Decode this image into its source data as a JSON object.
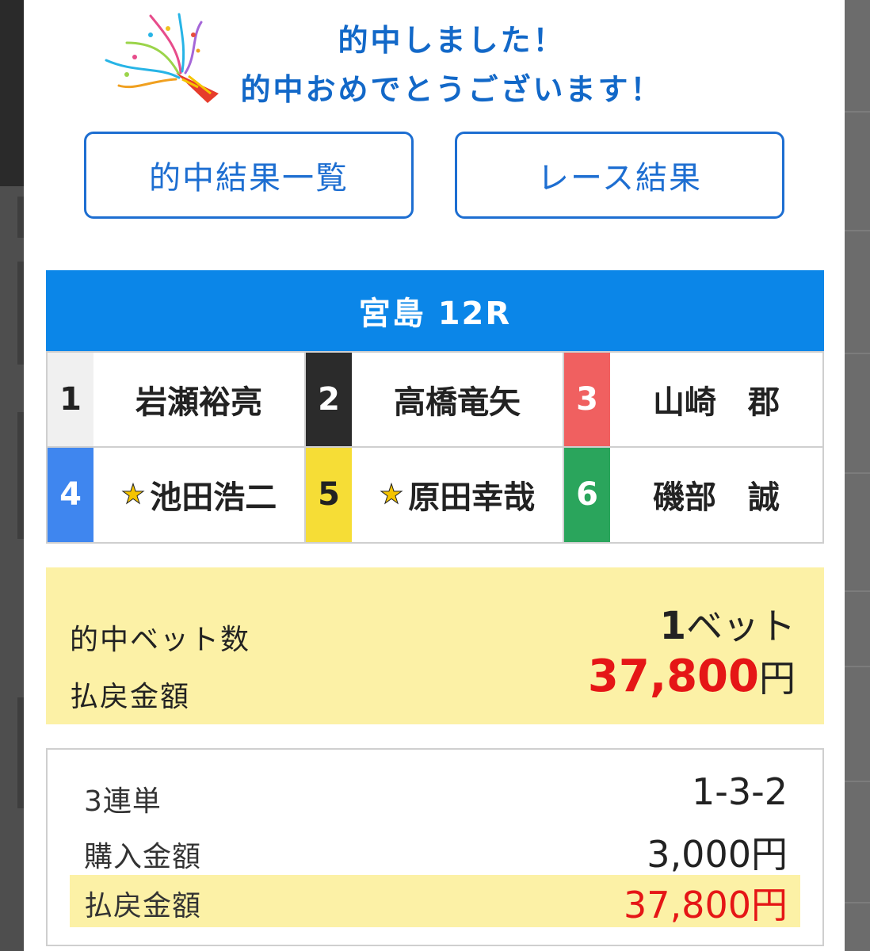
{
  "congrats": {
    "line1": "的中しました！",
    "line2": "的中おめでとうございます！"
  },
  "buttons": {
    "hit_list": "的中結果一覧",
    "race_result": "レース結果"
  },
  "race": {
    "title": "宮島 12R"
  },
  "racers": [
    {
      "number": "1",
      "name": "岩瀬裕亮",
      "starred": false,
      "bg": "#f0f0f0",
      "fg": "#222222"
    },
    {
      "number": "2",
      "name": "高橋竜矢",
      "starred": false,
      "bg": "#2b2b2b",
      "fg": "#ffffff"
    },
    {
      "number": "3",
      "name": "山崎　郡",
      "starred": false,
      "bg": "#f06060",
      "fg": "#ffffff"
    },
    {
      "number": "4",
      "name": "池田浩二",
      "starred": true,
      "bg": "#3f86ef",
      "fg": "#ffffff"
    },
    {
      "number": "5",
      "name": "原田幸哉",
      "starred": true,
      "bg": "#f6dd36",
      "fg": "#222222"
    },
    {
      "number": "6",
      "name": "磯部　誠",
      "starred": false,
      "bg": "#2aa55c",
      "fg": "#ffffff"
    }
  ],
  "summary": {
    "hit_bets_label": "的中ベット数",
    "hit_bets_count": "1",
    "hit_bets_unit": "ベット",
    "payout_label": "払戻金額",
    "payout_amount": "37,800",
    "payout_unit": "円"
  },
  "detail": {
    "bet_type_label": "3連単",
    "bet_combo": "1-3-2",
    "purchase_label": "購入金額",
    "purchase_amount": "3,000円",
    "payout_label": "払戻金額",
    "payout_amount": "37,800円"
  },
  "icons": {
    "party": "party-popper-icon",
    "star": "star-icon"
  },
  "colors": {
    "accent_blue": "#1268c8",
    "header_blue": "#0b86e8",
    "highlight_yellow": "#fcf1a6",
    "payout_red": "#e51616"
  }
}
